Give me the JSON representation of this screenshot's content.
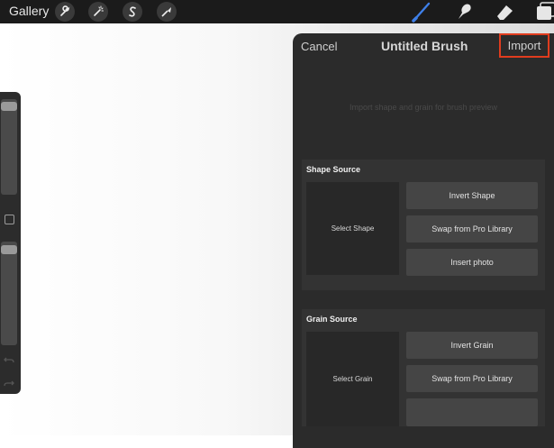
{
  "topbar": {
    "gallery_label": "Gallery",
    "action_icons": [
      "wrench-icon",
      "magic-wand-icon",
      "selection-s-icon",
      "transform-arrow-icon"
    ],
    "tool_icons": [
      "brush-icon",
      "smudge-icon",
      "eraser-icon",
      "layers-icon"
    ],
    "active_tool_color": "#3e7fe8"
  },
  "sidebar": {
    "size_slider_value": 0.0,
    "opacity_slider_value": 0.0
  },
  "brush_panel": {
    "cancel_label": "Cancel",
    "title": "Untitled Brush",
    "import_label": "Import",
    "import_highlight_color": "#e03c1e",
    "preview_text": "Import shape and grain for brush preview",
    "shape_source": {
      "title": "Shape Source",
      "select_label": "Select Shape",
      "buttons": [
        "Invert Shape",
        "Swap from Pro Library",
        "Insert photo"
      ]
    },
    "grain_source": {
      "title": "Grain Source",
      "select_label": "Select Grain",
      "buttons": [
        "Invert Grain",
        "Swap from Pro Library"
      ]
    }
  }
}
